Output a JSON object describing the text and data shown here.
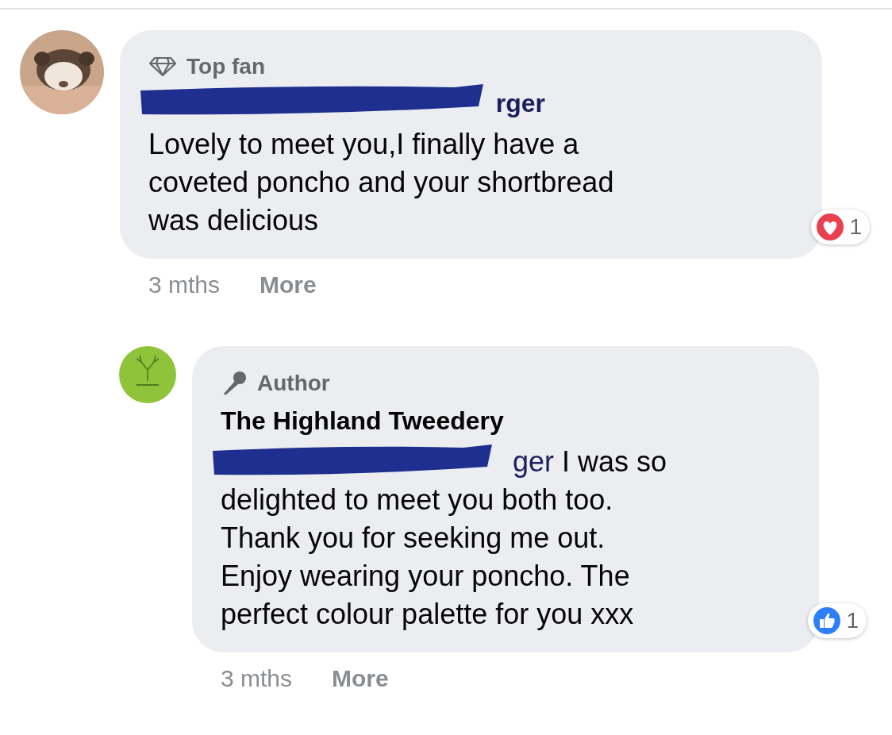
{
  "comments": [
    {
      "badge": {
        "kind": "top_fan",
        "label": "Top fan"
      },
      "name": {
        "redacted": true,
        "visible_tail": "rger"
      },
      "body": {
        "lines": [
          "Lovely to meet you,I finally have a",
          "coveted poncho and your shortbread",
          "was delicious"
        ]
      },
      "reaction": {
        "kind": "love",
        "count": "1"
      },
      "time": "3 mths",
      "more": "More",
      "reply": false
    },
    {
      "kind": "logo",
      "badge": {
        "kind": "author",
        "label": "Author"
      },
      "name": {
        "redacted": false,
        "text": "The Highland Tweedery"
      },
      "body": {
        "mention_tail": "ger",
        "lines": [
          " I was so",
          "delighted to meet you both too.",
          "Thank you for seeking me out.",
          "Enjoy wearing your poncho. The",
          "perfect colour palette for you xxx"
        ]
      },
      "reaction": {
        "kind": "like",
        "count": "1"
      },
      "time": "3 mths",
      "more": "More",
      "reply": true
    }
  ]
}
